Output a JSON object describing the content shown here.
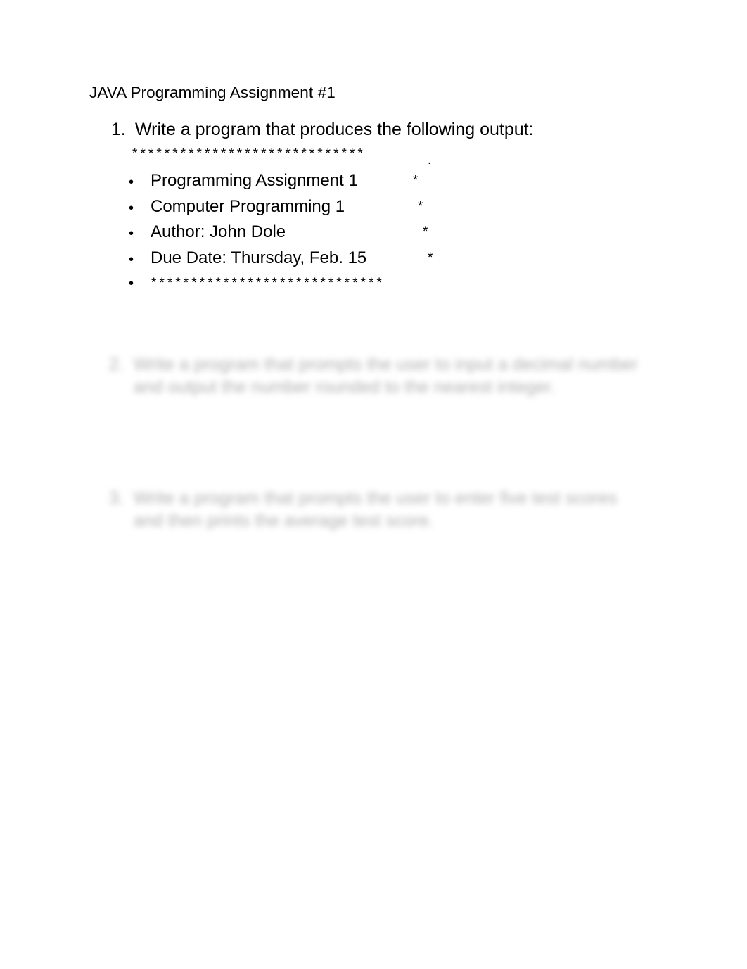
{
  "document": {
    "title": "JAVA Programming Assignment #1",
    "background_color": "#ffffff",
    "text_color": "#000000",
    "blurred_text_color": "#7f7f7f"
  },
  "items": [
    {
      "number": "1.",
      "text": "Write a program that produces the following output:",
      "blurred": false
    },
    {
      "number": "2.",
      "line1": "Write a program that prompts the user to input a decimal number",
      "line2": "and output the number rounded to the nearest integer.",
      "blurred": true
    },
    {
      "number": "3.",
      "line1": "Write a program that prompts the user to enter five test scores",
      "line2": "and then prints the average test score.",
      "blurred": true
    }
  ],
  "output_block": {
    "star_row_top": "*****************************",
    "trailing_dot": ".",
    "star_row_bottom": "*****************************",
    "bullet_marker": "•",
    "star_marker": "*",
    "lines": [
      {
        "label": "Programming Assignment 1",
        "star": "*"
      },
      {
        "label": "Computer Programming 1",
        "star": "*"
      },
      {
        "label": "Author:  John Dole",
        "star": "*"
      },
      {
        "label": "Due Date: Thursday, Feb. 15",
        "star": "*"
      }
    ]
  }
}
